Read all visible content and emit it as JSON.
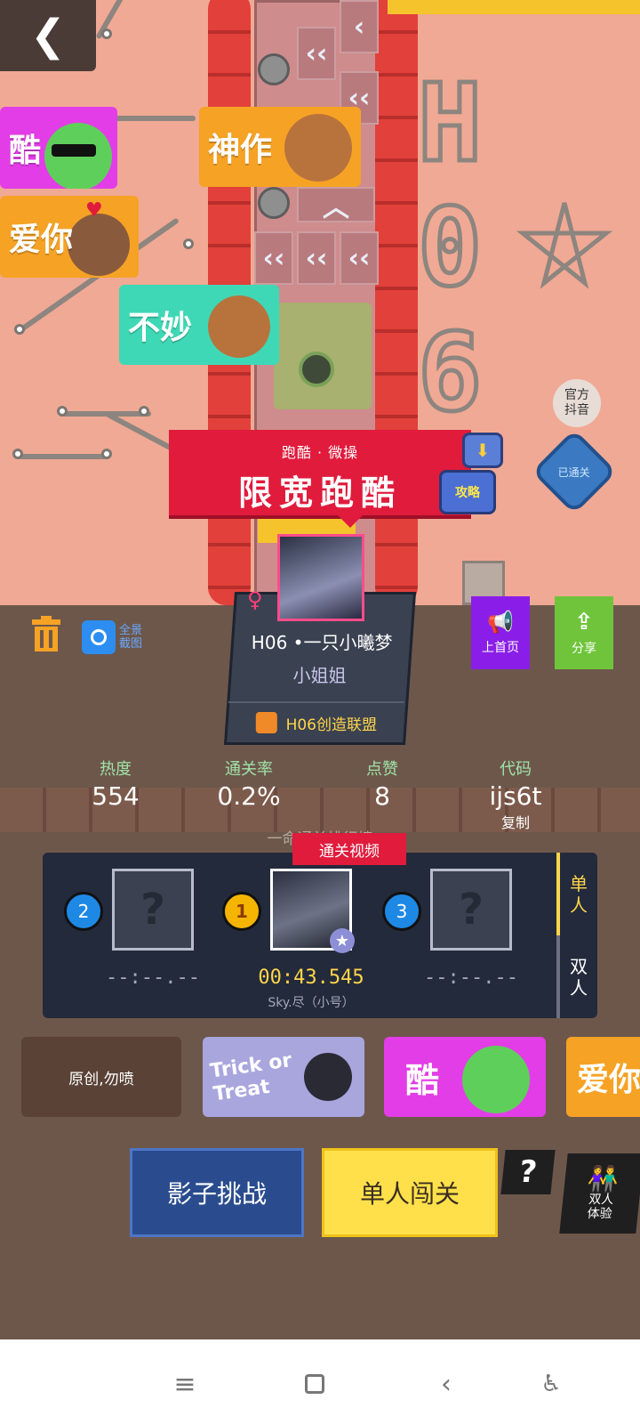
{
  "level": {
    "category": "跑酷 · 微操",
    "name": "限宽跑酷"
  },
  "stickers": {
    "left_top": "酷",
    "left_mid": "爱你",
    "left_low": "不妙",
    "center": "神作"
  },
  "right_icons": {
    "douyin": "官方\n抖音",
    "guide": "攻略",
    "cleared": "已通关"
  },
  "author": {
    "gender_symbol": "♀",
    "name": "H06 •一只小曦梦",
    "title": "小姐姐",
    "guild": "H06创造联盟"
  },
  "toolbar": {
    "panorama": "全景\n截图",
    "home_label": "上首页",
    "share_label": "分享"
  },
  "stats": {
    "heat_label": "热度",
    "heat_value": "554",
    "pass_label": "通关率",
    "pass_value": "0.2%",
    "like_label": "点赞",
    "like_value": "8",
    "code_label": "代码",
    "code_value": "ijs6t",
    "copy_label": "复制"
  },
  "ranking": {
    "caption": "一命通关排行榜",
    "video_label": "通关视频",
    "rank1": "1",
    "rank2": "2",
    "rank3": "3",
    "time1": "00:43.545",
    "player1": "Sky.尽（小号）",
    "time2": "--:--.--",
    "time3": "--:--.--",
    "placeholder": "?",
    "tab_single": "单\n人",
    "tab_double": "双\n人"
  },
  "tags": {
    "tag1": "原创,勿喷",
    "tag2": "Trick or Treat",
    "tag3": "酷",
    "tag4": "爱你"
  },
  "actions": {
    "shadow": "影子挑战",
    "solo": "单人闯关",
    "help": "?",
    "duo": "双人\n体验"
  },
  "colors": {
    "accent_red": "#e01b3c",
    "gold": "#ffd54a",
    "promo_purple": "#8a1ee8",
    "share_green": "#6fc43b",
    "shadow_blue": "#2a4c8f"
  }
}
